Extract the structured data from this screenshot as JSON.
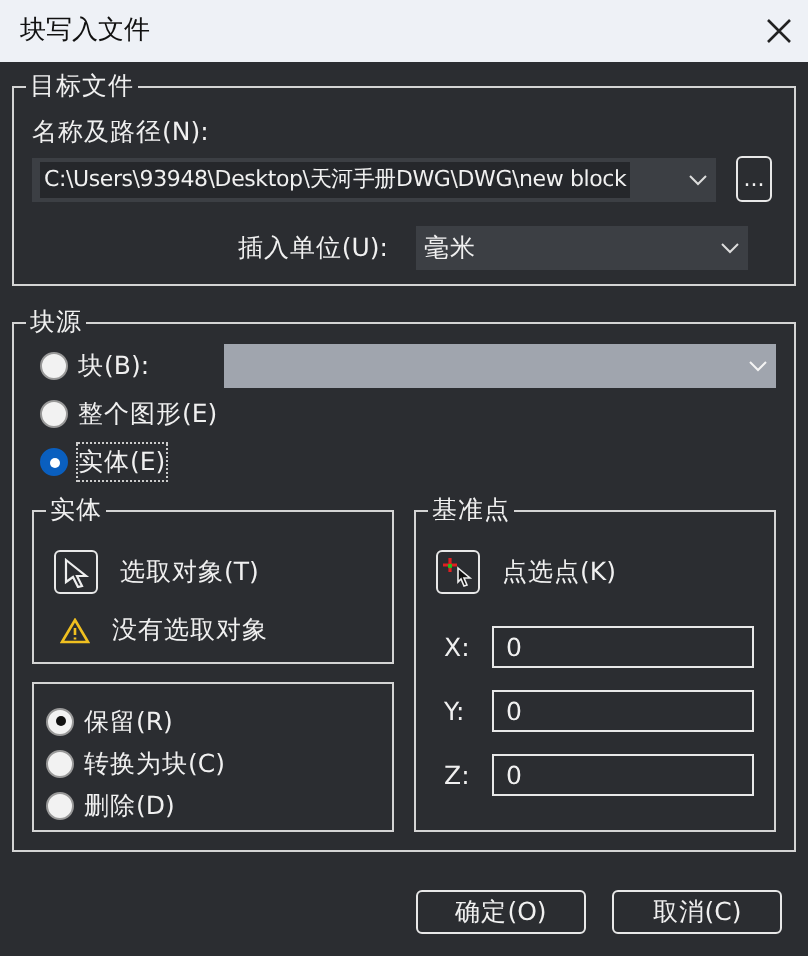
{
  "window": {
    "title": "块写入文件"
  },
  "target_file": {
    "legend": "目标文件",
    "path_label": "名称及路径(N):",
    "path_value": "C:\\Users\\93948\\Desktop\\天河手册DWG\\DWG\\new block",
    "browse_button": "...",
    "unit_label": "插入单位(U):",
    "unit_value": "毫米"
  },
  "source": {
    "legend": "块源",
    "block_combo": {
      "disabled": true
    },
    "options": [
      {
        "label": "块(B):",
        "selected": false,
        "focused": false
      },
      {
        "label": "整个图形(E)",
        "selected": false,
        "focused": false
      },
      {
        "label": "实体(E)",
        "selected": true,
        "focused": true
      }
    ]
  },
  "objects": {
    "legend": "实体",
    "select_button": "选取对象(T)",
    "warning": "没有选取对象"
  },
  "after_options": [
    {
      "label": "保留(R)",
      "selected": true
    },
    {
      "label": "转换为块(C)",
      "selected": false
    },
    {
      "label": "删除(D)",
      "selected": false
    }
  ],
  "base_point": {
    "legend": "基准点",
    "pick_button": "点选点(K)",
    "fields": [
      {
        "label": "X:",
        "value": "0"
      },
      {
        "label": "Y:",
        "value": "0"
      },
      {
        "label": "Z:",
        "value": "0"
      }
    ]
  },
  "buttons": [
    "确定(O)",
    "取消(C)"
  ]
}
